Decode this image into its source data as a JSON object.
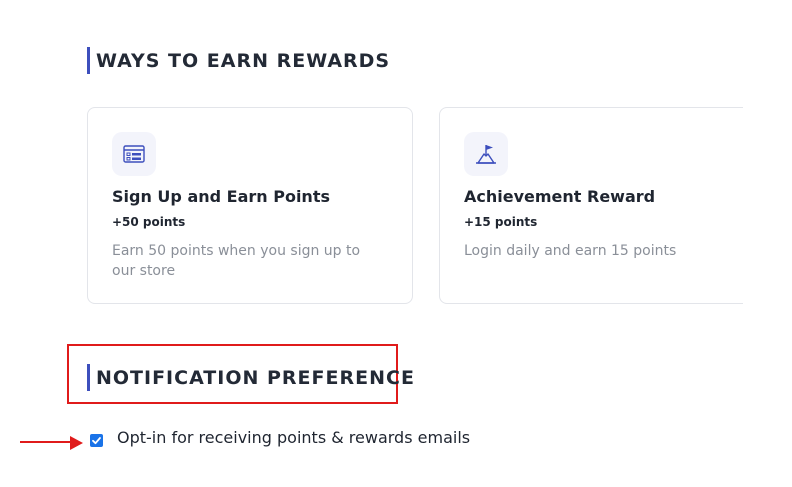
{
  "earn_section": {
    "title": "WAYS TO EARN REWARDS",
    "cards": [
      {
        "icon": "signup-form-icon",
        "title": "Sign Up and Earn Points",
        "points": "+50 points",
        "description": "Earn 50 points when you sign up to our store"
      },
      {
        "icon": "achievement-flag-icon",
        "title": "Achievement Reward",
        "points": "+15 points",
        "description": "Login daily and earn 15 points"
      }
    ]
  },
  "notification_section": {
    "title": "NOTIFICATION PREFERENCE",
    "opt_in": {
      "label": "Opt-in for receiving points & rewards emails",
      "checked": true
    }
  },
  "colors": {
    "accent": "#3d4fbd",
    "highlight": "#e01b1b",
    "checkbox": "#1a73e8"
  }
}
